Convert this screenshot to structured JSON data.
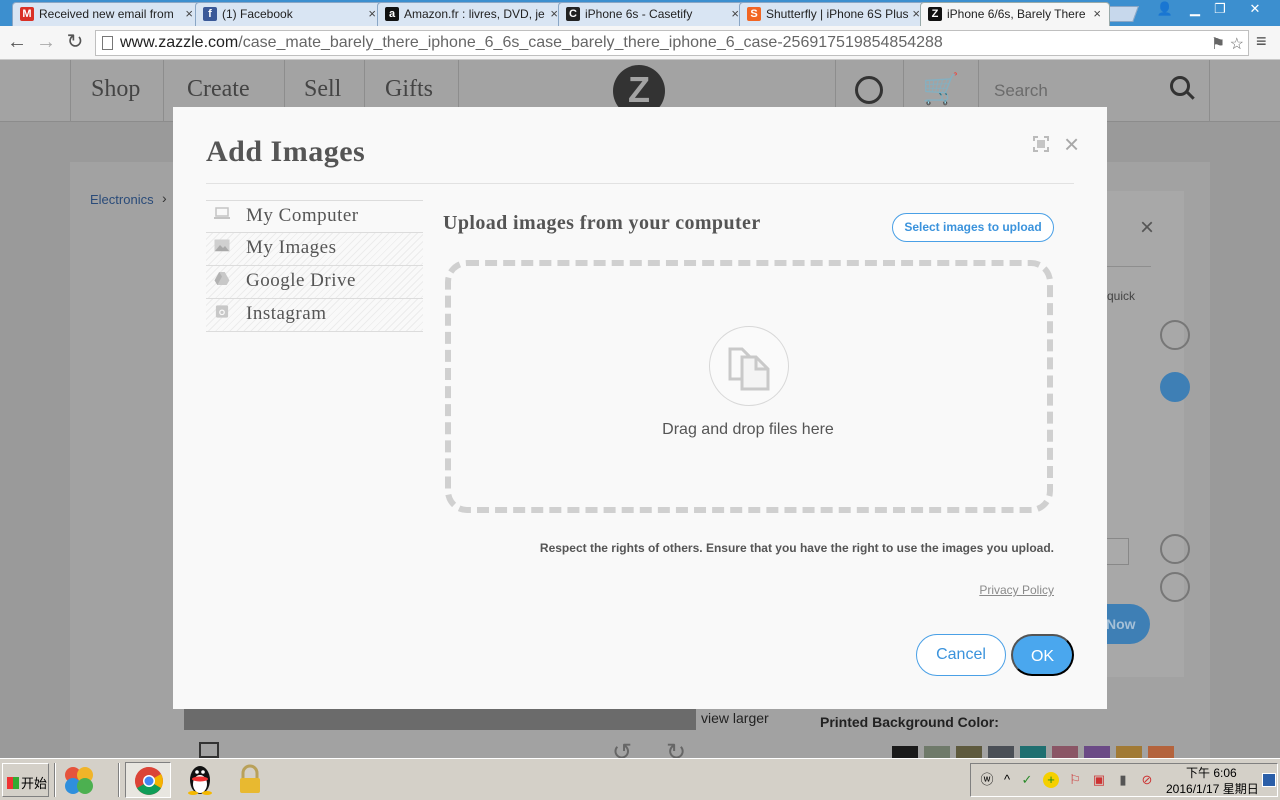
{
  "browser": {
    "tabs": [
      {
        "title": "Received new email from",
        "favicon": "gmail-icon",
        "color": "#d93025",
        "glyph": "M"
      },
      {
        "title": "(1) Facebook",
        "favicon": "facebook-icon",
        "color": "#3b5998",
        "glyph": "f"
      },
      {
        "title": "Amazon.fr : livres, DVD, je",
        "favicon": "amazon-icon",
        "color": "#111111",
        "glyph": "a"
      },
      {
        "title": "iPhone 6s - Casetify",
        "favicon": "casetify-icon",
        "color": "#222222",
        "glyph": "C"
      },
      {
        "title": "Shutterfly | iPhone 6S Plus",
        "favicon": "shutterfly-icon",
        "color": "#f26522",
        "glyph": "S"
      },
      {
        "title": "iPhone 6/6s, Barely There",
        "favicon": "zazzle-icon",
        "color": "#111111",
        "glyph": "Z"
      }
    ],
    "tab_close": "×",
    "url_domain": "www.zazzle.com",
    "url_path": "/case_mate_barely_there_iphone_6_6s_case_barely_there_iphone_6_case-256917519854854288",
    "nav": {
      "back": "←",
      "forward": "→",
      "reload": "↻",
      "menu": "≡"
    },
    "omni_icons": "⚑ ☆",
    "window_buttons": {
      "user": "👤",
      "minimize": "▁",
      "maximize": "❐",
      "close": "✕"
    }
  },
  "site": {
    "nav": [
      "Shop",
      "Create",
      "Sell",
      "Gifts"
    ],
    "logo": "Z",
    "search_placeholder": "Search",
    "breadcrumb": "Electronics",
    "breadcrumb_sep": "›",
    "side_panel": {
      "close": "×",
      "text": "quick",
      "button": "Now"
    },
    "view_larger": "view larger",
    "printed_bg_label": "Printed Background Color:",
    "swatches": [
      "#1a1a1a",
      "#6f7a6a",
      "#5e5a3e",
      "#4a4f56",
      "#1f6f70",
      "#8a5565",
      "#6b4a86",
      "#a17a35",
      "#b4633c"
    ],
    "cart_glyph": "🛒",
    "rotate_left": "↺",
    "rotate_right": "↻"
  },
  "modal": {
    "title": "Add Images",
    "close": "×",
    "sources": [
      {
        "label": "My Computer",
        "icon": "laptop-icon",
        "active": true
      },
      {
        "label": "My Images",
        "icon": "image-icon",
        "active": false
      },
      {
        "label": "Google Drive",
        "icon": "drive-icon",
        "active": false
      },
      {
        "label": "Instagram",
        "icon": "instagram-icon",
        "active": false
      }
    ],
    "upload_heading": "Upload images from your computer",
    "select_button": "Select images to upload",
    "drop_text": "Drag and drop files here",
    "rights_notice": "Respect the rights of others. Ensure that you have the right to use the images you upload.",
    "privacy_link": "Privacy Policy",
    "cancel": "Cancel",
    "ok": "OK",
    "accent": "#4aa7ee"
  },
  "taskbar": {
    "start": "开始",
    "clock_time": "下午 6:06",
    "clock_date": "2016/1/17 星期日",
    "apps": [
      "windows-media-icon",
      "chrome-icon",
      "qq-icon",
      "lock-icon"
    ],
    "tray_glyphs": [
      "ⓦ",
      "^",
      "✓",
      "+",
      "⚐",
      "▣",
      "▮",
      "⊘"
    ]
  }
}
